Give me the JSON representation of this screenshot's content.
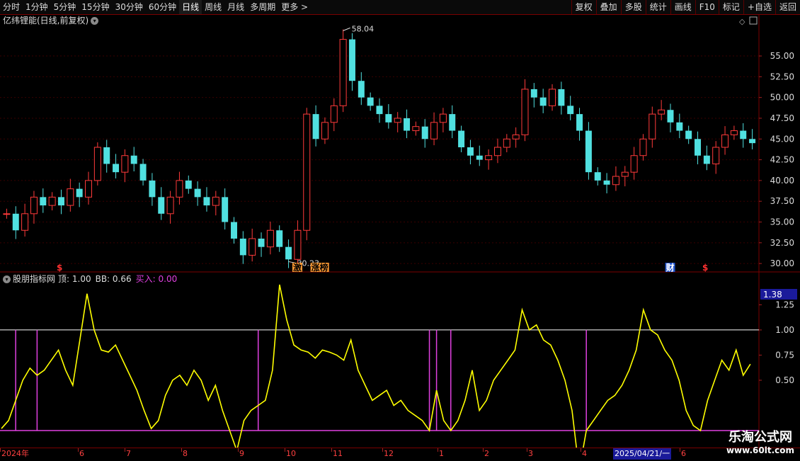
{
  "toolbar": {
    "periods": [
      "分时",
      "1分钟",
      "5分钟",
      "15分钟",
      "30分钟",
      "60分钟",
      "日线",
      "周线",
      "月线",
      "多周期",
      "更多 >"
    ],
    "active_period": "日线",
    "actions": [
      "复权",
      "叠加",
      "多股",
      "统计",
      "画线",
      "F10",
      "标记",
      "+自选",
      "返回"
    ]
  },
  "main_chart": {
    "title": "亿纬锂能(日线,前复权)",
    "high_label": "58.04",
    "low_label": "30.23",
    "y_axis_ticks": [
      "55.00",
      "52.50",
      "50.00",
      "47.50",
      "45.00",
      "42.50",
      "40.00",
      "37.50",
      "35.00",
      "32.50",
      "30.00"
    ],
    "markers": [
      {
        "text": "$",
        "color": "#ff3030",
        "bg": "none"
      },
      {
        "text": "激",
        "color": "#000000",
        "bg": "#ff9a33"
      },
      {
        "text": "涨榜",
        "color": "#000000",
        "bg": "#ff9a33"
      },
      {
        "text": "财",
        "color": "#ffffff",
        "bg": "#2255cc"
      },
      {
        "text": "$",
        "color": "#ff3030",
        "bg": "none"
      }
    ]
  },
  "indicator": {
    "name": "股朋指标网",
    "ding_label": "顶: 1.00",
    "bb_label": "BB: 0.66",
    "buy_label": "买入: 0.00",
    "y_axis_ticks": [
      "1.25",
      "1.00",
      "0.75",
      "0.50"
    ],
    "current_value": "1.38"
  },
  "time_axis": {
    "labels": [
      "2024年",
      "6",
      "7",
      "8",
      "9",
      "10",
      "11",
      "12",
      "1",
      "2",
      "3",
      "4",
      "6"
    ],
    "cursor_date": "2025/04/21/一"
  },
  "watermark": {
    "title": "乐淘公式网",
    "url": "www.60lt.com"
  },
  "colors": {
    "up": "#ff3a3a",
    "down": "#50e0e0",
    "yellow": "#ffff00",
    "magenta": "#e040e0",
    "white": "#ffffff",
    "border": "#7a0000"
  },
  "chart_data": {
    "type": "candlestick",
    "title": "亿纬锂能(日线,前复权)",
    "ylim": [
      29.5,
      58.5
    ],
    "key_points": [
      {
        "label": "high",
        "value": 58.04
      },
      {
        "label": "low",
        "value": 30.23
      }
    ],
    "close_path": [
      36,
      34,
      36,
      38,
      37,
      38,
      37,
      39,
      38,
      40,
      44,
      42,
      41,
      43,
      42,
      40,
      38,
      36,
      38,
      40,
      39,
      38,
      37,
      38,
      35,
      33,
      31,
      33,
      32,
      34,
      32,
      30.5,
      34,
      48,
      45,
      47,
      49,
      57,
      52,
      50,
      49,
      48,
      47,
      47.5,
      46,
      46.5,
      45,
      47,
      48,
      46,
      44,
      43,
      42.5,
      43,
      44,
      45,
      45.5,
      51,
      50,
      49,
      51,
      49,
      48,
      46,
      41,
      40,
      39.5,
      40.5,
      41,
      43,
      45,
      48,
      48.5,
      47,
      46,
      45,
      43,
      42,
      44,
      45.5,
      46,
      45,
      44.5
    ],
    "indicator": {
      "name": "股朋指标网",
      "ding": 1.0,
      "bb": 0.66,
      "buy": 0.0,
      "ylim": [
        0.0,
        1.45
      ],
      "reference_lines": [
        1.0,
        0.0
      ],
      "bb_path": [
        0.02,
        0.1,
        0.3,
        0.5,
        0.62,
        0.55,
        0.6,
        0.7,
        0.8,
        0.6,
        0.45,
        0.9,
        1.36,
        1.0,
        0.8,
        0.78,
        0.85,
        0.7,
        0.55,
        0.4,
        0.2,
        0.02,
        0.1,
        0.35,
        0.5,
        0.55,
        0.45,
        0.6,
        0.5,
        0.3,
        0.45,
        0.2,
        0.0,
        -0.2,
        0.1,
        0.2,
        0.25,
        0.3,
        0.6,
        1.45,
        1.1,
        0.85,
        0.8,
        0.78,
        0.72,
        0.8,
        0.78,
        0.75,
        0.7,
        0.9,
        0.6,
        0.45,
        0.3,
        0.35,
        0.4,
        0.25,
        0.3,
        0.2,
        0.15,
        0.1,
        0.0,
        0.4,
        0.1,
        0.0,
        0.1,
        0.3,
        0.6,
        0.2,
        0.3,
        0.5,
        0.6,
        0.7,
        0.8,
        1.2,
        1.0,
        1.05,
        0.9,
        0.85,
        0.7,
        0.5,
        0.2,
        -0.4,
        0.0,
        0.1,
        0.2,
        0.3,
        0.35,
        0.45,
        0.6,
        0.8,
        1.2,
        1.0,
        0.95,
        0.8,
        0.7,
        0.5,
        0.2,
        0.05,
        0.0,
        0.3,
        0.5,
        0.7,
        0.6,
        0.8,
        0.55,
        0.66
      ],
      "buy_spikes": [
        2,
        5,
        36,
        60,
        61,
        63,
        82
      ]
    }
  }
}
